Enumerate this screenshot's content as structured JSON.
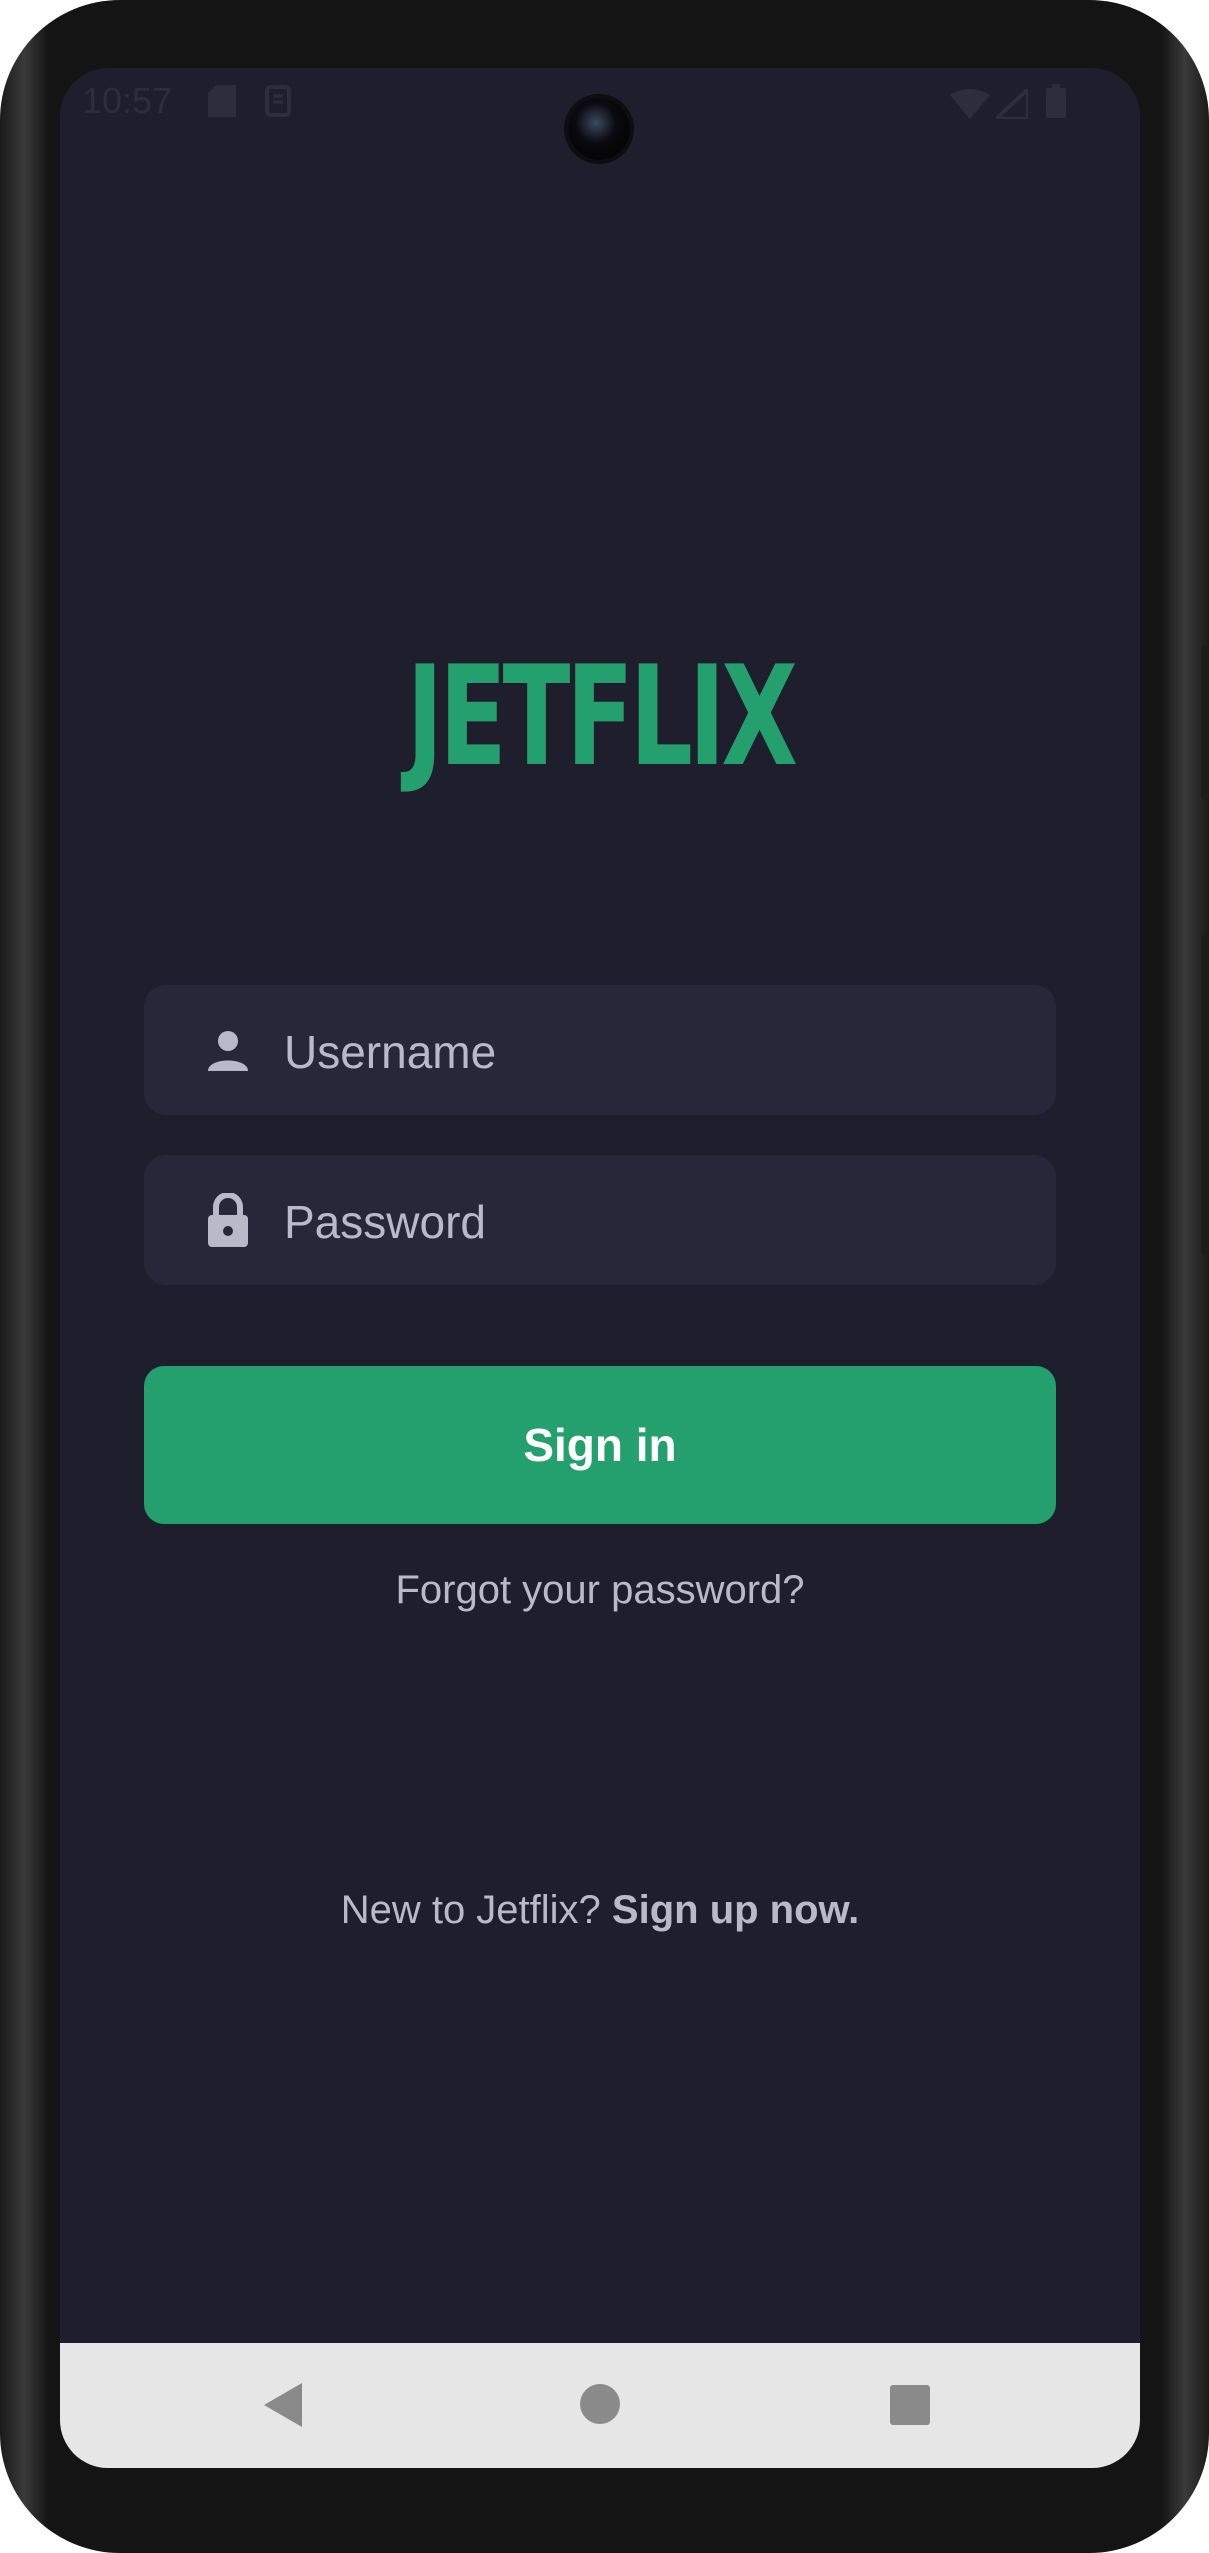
{
  "status_bar": {
    "time": "10:57",
    "icons": [
      "sd-card-icon",
      "notification-icon",
      "wifi-icon",
      "signal-icon",
      "battery-icon"
    ]
  },
  "app": {
    "logo_text": "JETFLIX",
    "username_placeholder": "Username",
    "password_placeholder": "Password",
    "signin_label": "Sign in",
    "forgot_label": "Forgot your password?",
    "signup_prompt": "New to Jetflix? ",
    "signup_link": "Sign up now."
  },
  "nav_bar": {
    "buttons": [
      "back-icon",
      "home-icon",
      "recents-icon"
    ]
  },
  "colors": {
    "background": "#1f1e2c",
    "field_background": "#262839",
    "accent": "#23a06d",
    "muted_text": "#b9bac9"
  }
}
